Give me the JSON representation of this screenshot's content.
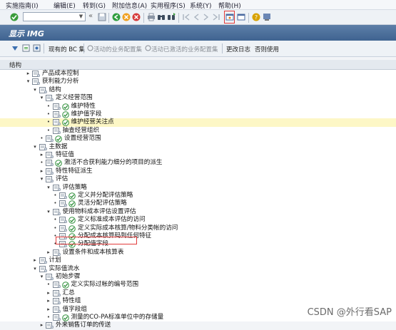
{
  "menubar": {
    "items": [
      {
        "label": "实施指南(I)"
      },
      {
        "label": "编辑(E)"
      },
      {
        "label": "转到(G)"
      },
      {
        "label": "附加信息(A)"
      },
      {
        "label": "实用程序(S)"
      },
      {
        "label": "系统(Y)"
      },
      {
        "label": "帮助(H)"
      }
    ]
  },
  "window": {
    "title": "显示 IMG"
  },
  "toolbar": {
    "my_bc_sets": "现有的 BC 集",
    "activity_bc_sets": "活动的业务配置集",
    "activated_bc_sets": "活动已激活的业务配置集",
    "change_log": "更改日志",
    "release": "否则使用"
  },
  "tree": {
    "header": "结构",
    "rows": [
      {
        "level": 1,
        "label": "产品成本控制",
        "exp": "▸",
        "exec": false
      },
      {
        "level": 1,
        "label": "获利能力分析",
        "exp": "▾",
        "exec": false
      },
      {
        "level": 2,
        "label": "结构",
        "exp": "▾",
        "exec": false
      },
      {
        "level": 3,
        "label": "定义经营范围",
        "exp": "▾",
        "exec": false
      },
      {
        "level": 4,
        "label": "维护特性",
        "exp": "•",
        "exec": true
      },
      {
        "level": 4,
        "label": "维护值字段",
        "exp": "•",
        "exec": true
      },
      {
        "level": 4,
        "label": "维护经营关注点",
        "exp": "•",
        "exec": true,
        "highlight": true
      },
      {
        "level": 4,
        "label": "抽查经营组织",
        "exp": "•",
        "exec": false
      },
      {
        "level": 3,
        "label": "设置经营范围",
        "exp": "•",
        "exec": true
      },
      {
        "level": 2,
        "label": "主数据",
        "exp": "▾",
        "exec": false
      },
      {
        "level": 3,
        "label": "特征值",
        "exp": "▸",
        "exec": false
      },
      {
        "level": 3,
        "label": "激活不合获利能力细分的项目的派生",
        "exp": "•",
        "exec": true
      },
      {
        "level": 3,
        "label": "特性特征派生",
        "exp": "▸",
        "exec": false
      },
      {
        "level": 3,
        "label": "评估",
        "exp": "▾",
        "exec": false
      },
      {
        "level": 4,
        "label": "评估策略",
        "exp": "▾",
        "exec": false
      },
      {
        "level": 5,
        "label": "定义并分配评估策略",
        "exp": "•",
        "exec": true
      },
      {
        "level": 5,
        "label": "灵活分配评估策略",
        "exp": "•",
        "exec": true
      },
      {
        "level": 4,
        "label": "使用物料成本评估设置评估",
        "exp": "▾",
        "exec": false
      },
      {
        "level": 5,
        "label": "定义标准成本评估的访问",
        "exp": "•",
        "exec": true
      },
      {
        "level": 5,
        "label": "定义实际成本核算/物料分类帐的访问",
        "exp": "•",
        "exec": true
      },
      {
        "level": 5,
        "label": "分配成本核算码到任何特征",
        "exp": "•",
        "exec": true
      },
      {
        "level": 5,
        "label": "分配值字段",
        "exp": "•",
        "exec": true,
        "boxed": true
      },
      {
        "level": 4,
        "label": "设置条件和成本核算表",
        "exp": "▸",
        "exec": false
      },
      {
        "level": 2,
        "label": "计划",
        "exp": "▸",
        "exec": false
      },
      {
        "level": 2,
        "label": "实际值流水",
        "exp": "▾",
        "exec": false
      },
      {
        "level": 3,
        "label": "初始步骤",
        "exp": "▾",
        "exec": false
      },
      {
        "level": 4,
        "label": "定义实际过帐的编号范围",
        "exp": "•",
        "exec": true
      },
      {
        "level": 4,
        "label": "汇总",
        "exp": "▸",
        "exec": false
      },
      {
        "level": 4,
        "label": "特性组",
        "exp": "▸",
        "exec": false
      },
      {
        "level": 4,
        "label": "值字段组",
        "exp": "▸",
        "exec": false
      },
      {
        "level": 4,
        "label": "测量的CO-PA标准单位中的存储量",
        "exp": "•",
        "exec": true
      },
      {
        "level": 3,
        "label": "外来销售订单的传送",
        "exp": "▸",
        "exec": false
      }
    ]
  },
  "watermark": "CSDN @外行看SAP"
}
